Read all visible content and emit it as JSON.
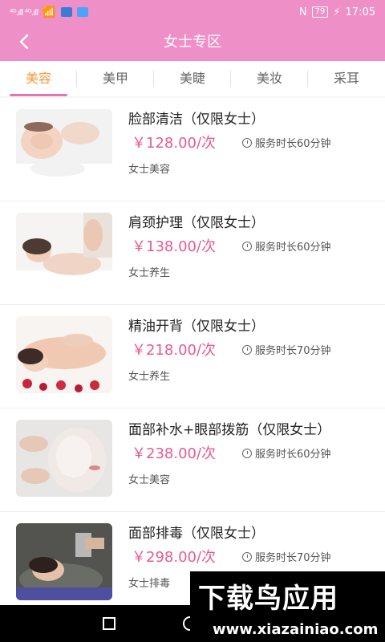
{
  "statusbar": {
    "left": "⁴ᴳ.ıll ⁴ᴳ.ıll",
    "nfc": "N",
    "battery": "79",
    "time": "17:05"
  },
  "header": {
    "title": "女士专区",
    "back_icon": "chevron-left-icon"
  },
  "tabs": [
    {
      "label": "美容",
      "active": true
    },
    {
      "label": "美甲",
      "active": false
    },
    {
      "label": "美睫",
      "active": false
    },
    {
      "label": "美妆",
      "active": false
    },
    {
      "label": "采耳",
      "active": false
    }
  ],
  "services": [
    {
      "name": "脸部清洁（仅限女士）",
      "price": "￥128.00/次",
      "duration": "服务时长60分钟",
      "category": "女士美容"
    },
    {
      "name": "肩颈护理（仅限女士）",
      "price": "￥138.00/次",
      "duration": "服务时长60分钟",
      "category": "女士养生"
    },
    {
      "name": "精油开背（仅限女士）",
      "price": "￥218.00/次",
      "duration": "服务时长70分钟",
      "category": "女士养生"
    },
    {
      "name": "面部补水+眼部拨筋（仅限女士）",
      "price": "￥238.00/次",
      "duration": "服务时长60分钟",
      "category": "女士美容"
    },
    {
      "name": "面部排毒（仅限女士）",
      "price": "￥298.00/次",
      "duration": "服务时长70分钟",
      "category": "女士排毒"
    }
  ],
  "watermark": {
    "main": "下载鸟应用",
    "url": "www.xiazainiao.com"
  },
  "colors": {
    "primary": "#ef8fc7",
    "price": "#e75b93",
    "tab_active": "#f39a3e",
    "underline": "#e872b7"
  }
}
